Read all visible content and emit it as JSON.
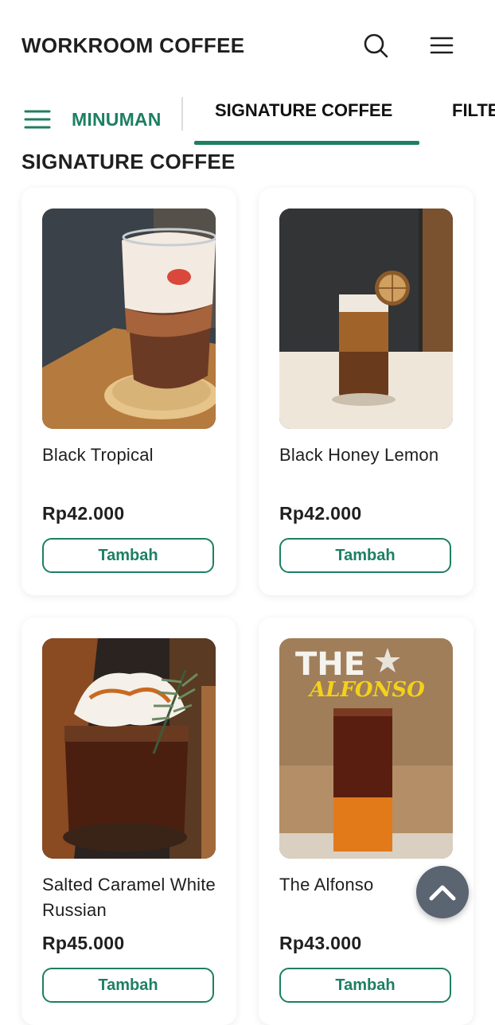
{
  "header": {
    "brand": "WORKROOM COFFEE",
    "search_icon": "search-icon",
    "menu_icon": "hamburger-menu-icon"
  },
  "category_nav": {
    "category_label": "MINUMAN",
    "tabs": [
      {
        "label": "SIGNATURE COFFEE",
        "active": true
      },
      {
        "label": "FILTER COFFEE",
        "active": false
      }
    ],
    "accent_color": "#1d7f63"
  },
  "section": {
    "title": "SIGNATURE COFFEE"
  },
  "products": [
    {
      "name": "Black Tropical",
      "price": "Rp42.000",
      "button": "Tambah"
    },
    {
      "name": "Black Honey Lemon",
      "price": "Rp42.000",
      "button": "Tambah"
    },
    {
      "name": "Salted Caramel White Russian",
      "price": "Rp45.000",
      "button": "Tambah"
    },
    {
      "name": "The Alfonso",
      "price": "Rp43.000",
      "button": "Tambah",
      "image_text_1": "THE",
      "image_text_2": "ALFONSO"
    }
  ],
  "fab": {
    "icon": "chevron-up-icon"
  }
}
